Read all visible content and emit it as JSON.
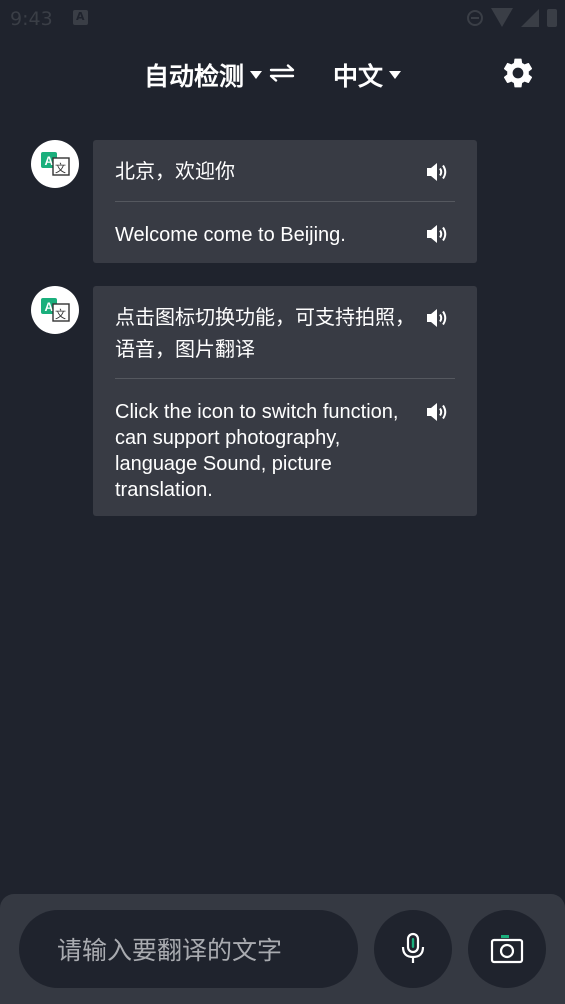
{
  "status_bar": {
    "time": "9:43"
  },
  "header": {
    "source_language": "自动检测",
    "target_language": "中文"
  },
  "messages": [
    {
      "source_text": "北京，欢迎你",
      "translated_text": "Welcome come to Beijing."
    },
    {
      "source_text": "点击图标切换功能，可支持拍照，语音，图片翻译",
      "translated_text": "Click the icon to switch function, can support photography, language Sound, picture translation."
    }
  ],
  "input": {
    "placeholder": "请输入要翻译的文字"
  },
  "colors": {
    "background": "#1f232d",
    "bubble": "#383b44",
    "bottom_bar": "#353942",
    "accent_green": "#1aaf7c"
  },
  "icons": [
    "swap-icon",
    "settings-gear-icon",
    "translate-icon",
    "speaker-icon",
    "microphone-icon",
    "camera-icon"
  ]
}
